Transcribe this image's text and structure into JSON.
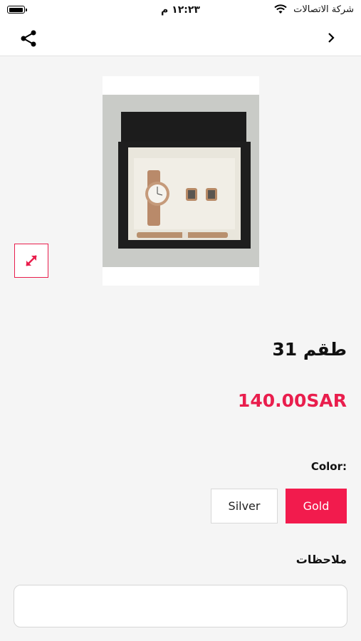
{
  "status": {
    "carrier": "شركة الاتصالات",
    "time": "١٢:٢٣ م"
  },
  "icons": {
    "share": "share-icon",
    "back": "chevron-right-icon",
    "expand": "expand-arrows-icon",
    "wifi": "wifi-icon",
    "battery": "battery-icon"
  },
  "product": {
    "image_alt": "watch, cufflinks and pen gift set",
    "title": "طقم 31",
    "price": "140.00SAR"
  },
  "options": {
    "color_label": "Color:",
    "colors": [
      "Gold",
      "Silver"
    ],
    "selected": "Gold"
  },
  "notes": {
    "label": "ملاحظات",
    "value": ""
  },
  "colors": {
    "accent": "#f21b4d",
    "price": "#e91e4d"
  }
}
